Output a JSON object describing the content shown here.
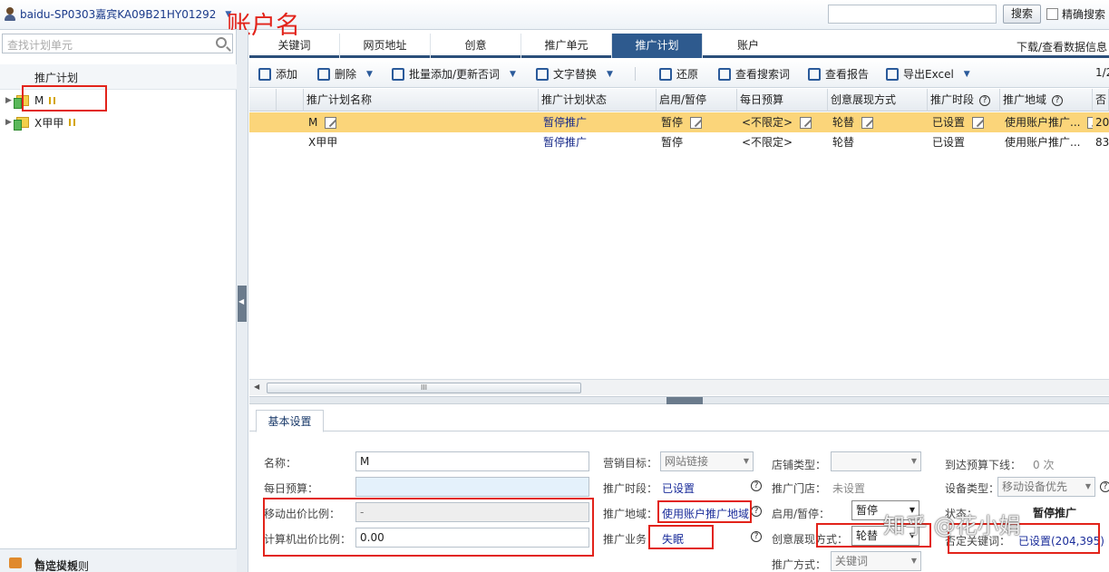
{
  "topbar": {
    "account": "baidu-SP0303嘉宾KA09B21HY01292",
    "annotation": "账户名",
    "search_button": "搜索",
    "exact_search": "精确搜索"
  },
  "sidebar": {
    "search_placeholder": "查找计划单元",
    "section_title": "推广计划",
    "plans": [
      {
        "label": "M"
      },
      {
        "label": "X甲甲"
      }
    ],
    "bottom_panel": "筛选模板",
    "rules": "自定义规则"
  },
  "tabs": [
    {
      "label": "关键词"
    },
    {
      "label": "网页地址"
    },
    {
      "label": "创意"
    },
    {
      "label": "推广单元"
    },
    {
      "label": "推广计划",
      "active": true
    },
    {
      "label": "账户"
    }
  ],
  "download_link": "下载/查看数据信息",
  "toolbar": {
    "add": "添加",
    "delete": "删除",
    "batch": "批量添加/更新否词",
    "replace": "文字替换",
    "restore": "还原",
    "search_terms": "查看搜索词",
    "report": "查看报告",
    "export": "导出Excel",
    "page": "1/2"
  },
  "grid": {
    "columns": [
      "推广计划名称",
      "推广计划状态",
      "启用/暂停",
      "每日预算",
      "创意展现方式",
      "推广时段",
      "推广地域",
      "否"
    ],
    "rows": [
      {
        "name": "M",
        "status": "暂停推广",
        "enabled": "暂停",
        "budget": "<不限定>",
        "mode": "轮替",
        "time": "已设置",
        "region": "使用账户推广...",
        "neg": "20"
      },
      {
        "name": "X甲甲",
        "status": "暂停推广",
        "enabled": "暂停",
        "budget": "<不限定>",
        "mode": "轮替",
        "time": "已设置",
        "region": "使用账户推广...",
        "neg": "83"
      }
    ],
    "scroll_grip": "III"
  },
  "detail": {
    "tab": "基本设置",
    "name_label": "名称：",
    "name_value": "M",
    "budget_label": "每日预算：",
    "mobile_ratio_label": "移动出价比例：",
    "mobile_ratio_value": "-",
    "pc_ratio_label": "计算机出价比例：",
    "pc_ratio_value": "0.00",
    "goal_label": "营销目标：",
    "goal_value": "网站链接",
    "time_label": "推广时段：",
    "time_value": "已设置",
    "region_label": "推广地域：",
    "region_value": "使用账户推广地域",
    "biz_label": "推广业务：",
    "biz_value": "失眠",
    "shop_type_label": "店铺类型：",
    "shop_label": "推广门店：",
    "shop_value": "未设置",
    "enable_label": "启用/暂停：",
    "enable_value": "暂停",
    "mode_label": "创意展现方式：",
    "mode_value": "轮替",
    "method_label": "推广方式：",
    "method_value": "关键词",
    "offline_label": "到达预算下线：",
    "offline_value": "0 次",
    "device_label": "设备类型：",
    "device_value": "移动设备优先",
    "state_label": "状态：",
    "state_value": "暂停推广",
    "neg_label": "否定关键词：",
    "neg_value": "已设置(204,395)"
  },
  "watermark": "知乎 @花小娟"
}
